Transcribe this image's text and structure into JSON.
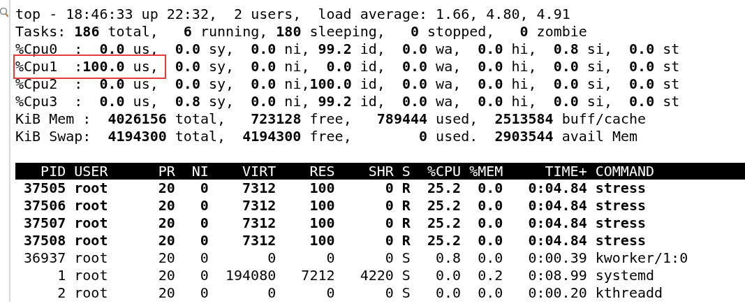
{
  "summary": [
    {
      "text": "top - 18:46:33 up 22:32,  2 users,  load average: 1.66, 4.80, 4.91",
      "boxed": false
    },
    {
      "text": "Tasks: **186** total,   **6** running, **180** sleeping,   **0** stopped,   **0** zombie",
      "boxed": false
    },
    {
      "text": "%Cpu0  :  **0.0** us,  **0.0** sy,  **0.0** ni, **99.2** id,  **0.0** wa,  **0.0** hi,  **0.8** si,  **0.0** st",
      "boxed": false
    },
    {
      "text": "%Cpu1  :**100.0** us,  **0.0** sy,  **0.0** ni,  **0.0** id,  **0.0** wa,  **0.0** hi,  **0.0** si,  **0.0** st",
      "boxed": true
    },
    {
      "text": "%Cpu2  :  **0.0** us,  **0.0** sy,  **0.0** ni,**100.0** id,  **0.0** wa,  **0.0** hi,  **0.0** si,  **0.0** st",
      "boxed": false
    },
    {
      "text": "%Cpu3  :  **0.0** us,  **0.8** sy,  **0.0** ni, **99.2** id,  **0.0** wa,  **0.0** hi,  **0.0** si,  **0.0** st",
      "boxed": false
    },
    {
      "text": "KiB Mem :  **4026156** total,   **723128** free,   **789444** used,  **2513584** buff/cache",
      "boxed": false
    },
    {
      "text": "KiB Swap:  **4194300** total,  **4194300** free,        **0** used.  **2903544** avail Mem",
      "boxed": false
    }
  ],
  "table": {
    "columns": [
      "PID",
      "USER",
      "PR",
      "NI",
      "VIRT",
      "RES",
      "SHR",
      "S",
      "%CPU",
      "%MEM",
      "TIME+",
      "COMMAND"
    ],
    "rows": [
      {
        "highlighted": true,
        "cells": [
          "37505",
          "root",
          "20",
          "0",
          "7312",
          "100",
          "0",
          "R",
          "25.2",
          "0.0",
          "0:04.84",
          "stress"
        ]
      },
      {
        "highlighted": true,
        "cells": [
          "37506",
          "root",
          "20",
          "0",
          "7312",
          "100",
          "0",
          "R",
          "25.2",
          "0.0",
          "0:04.84",
          "stress"
        ]
      },
      {
        "highlighted": true,
        "cells": [
          "37507",
          "root",
          "20",
          "0",
          "7312",
          "100",
          "0",
          "R",
          "25.2",
          "0.0",
          "0:04.84",
          "stress"
        ]
      },
      {
        "highlighted": true,
        "cells": [
          "37508",
          "root",
          "20",
          "0",
          "7312",
          "100",
          "0",
          "R",
          "25.2",
          "0.0",
          "0:04.84",
          "stress"
        ]
      },
      {
        "highlighted": false,
        "cells": [
          "36937",
          "root",
          "20",
          "0",
          "0",
          "0",
          "0",
          "S",
          "0.8",
          "0.0",
          "0:00.39",
          "kworker/1:0"
        ]
      },
      {
        "highlighted": false,
        "cells": [
          "1",
          "root",
          "20",
          "0",
          "194080",
          "7212",
          "4220",
          "S",
          "0.0",
          "0.2",
          "0:08.99",
          "systemd"
        ]
      },
      {
        "highlighted": false,
        "cells": [
          "2",
          "root",
          "20",
          "0",
          "0",
          "0",
          "0",
          "S",
          "0.0",
          "0.0",
          "0:00.20",
          "kthreadd"
        ]
      }
    ]
  }
}
